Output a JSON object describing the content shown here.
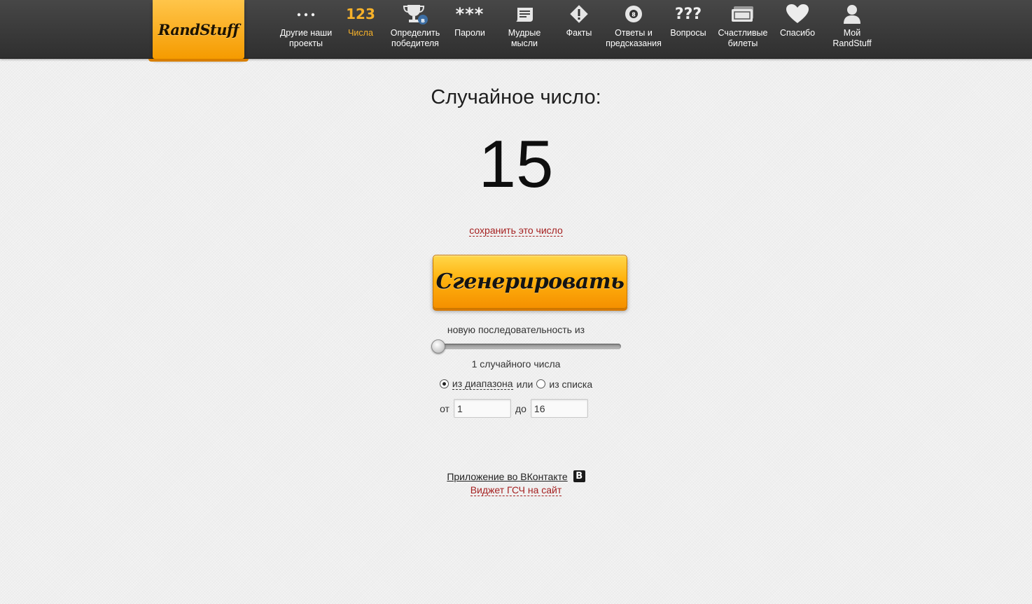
{
  "logo": {
    "text": "RandStuff"
  },
  "nav": [
    {
      "label": "Другие наши\nпроекты",
      "icon": "more-dots-icon",
      "glyph": "•••"
    },
    {
      "label": "Числа",
      "icon": "numbers-icon",
      "glyph": "123",
      "active": true
    },
    {
      "label": "Определить\nпобедителя",
      "icon": "trophy-icon",
      "glyph": ""
    },
    {
      "label": "Пароли",
      "icon": "password-asterisks-icon",
      "glyph": "***"
    },
    {
      "label": "Мудрые\nмысли",
      "icon": "scroll-icon",
      "glyph": ""
    },
    {
      "label": "Факты",
      "icon": "warning-diamond-icon",
      "glyph": ""
    },
    {
      "label": "Ответы и\nпредсказания",
      "icon": "magic-8-ball-icon",
      "glyph": ""
    },
    {
      "label": "Вопросы",
      "icon": "question-marks-icon",
      "glyph": "???"
    },
    {
      "label": "Счастливые\nбилеты",
      "icon": "ticket-icon",
      "glyph": ""
    },
    {
      "label": "Спасибо",
      "icon": "heart-icon",
      "glyph": ""
    },
    {
      "label": "Мой\nRandStuff",
      "icon": "user-icon",
      "glyph": ""
    }
  ],
  "result": {
    "title": "Случайное число:",
    "number": "15",
    "save_link": "сохранить это число"
  },
  "generate_button": {
    "label": "Сгенерировать"
  },
  "sequence": {
    "label": "новую последовательность из",
    "slider_value": 1,
    "count_label": "1 случайного числа"
  },
  "mode": {
    "range_label": "из диапазона",
    "or": "или",
    "list_label": "из списка",
    "selected": "range"
  },
  "range": {
    "from_label": "от",
    "from_value": "1",
    "to_label": "до",
    "to_value": "16"
  },
  "footer": {
    "vk_app": "Приложение во ВКонтакте",
    "vk_badge": "B",
    "widget": "Виджет ГСЧ на сайт"
  },
  "colors": {
    "accent": "#f7b22a",
    "button": "#ffb20e",
    "link_red": "#a52020",
    "topbar": "#3a3a3a"
  }
}
